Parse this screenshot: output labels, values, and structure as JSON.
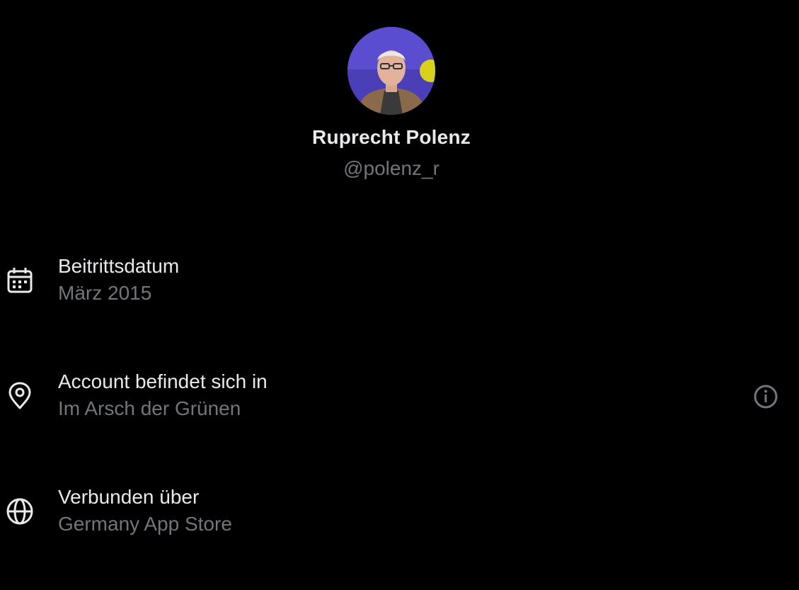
{
  "colors": {
    "background": "#000000",
    "primary_text": "#e7e9ea",
    "secondary_text": "#71767b"
  },
  "profile": {
    "display_name": "Ruprecht Polenz",
    "handle": "@polenz_r"
  },
  "details": [
    {
      "icon": "calendar-icon",
      "label": "Beitrittsdatum",
      "value": "März 2015"
    },
    {
      "icon": "location-pin-icon",
      "label": "Account befindet sich in",
      "value": "Im Arsch der Grünen",
      "action_icon": "info-icon"
    },
    {
      "icon": "globe-icon",
      "label": "Verbunden über",
      "value": "Germany App Store"
    }
  ]
}
